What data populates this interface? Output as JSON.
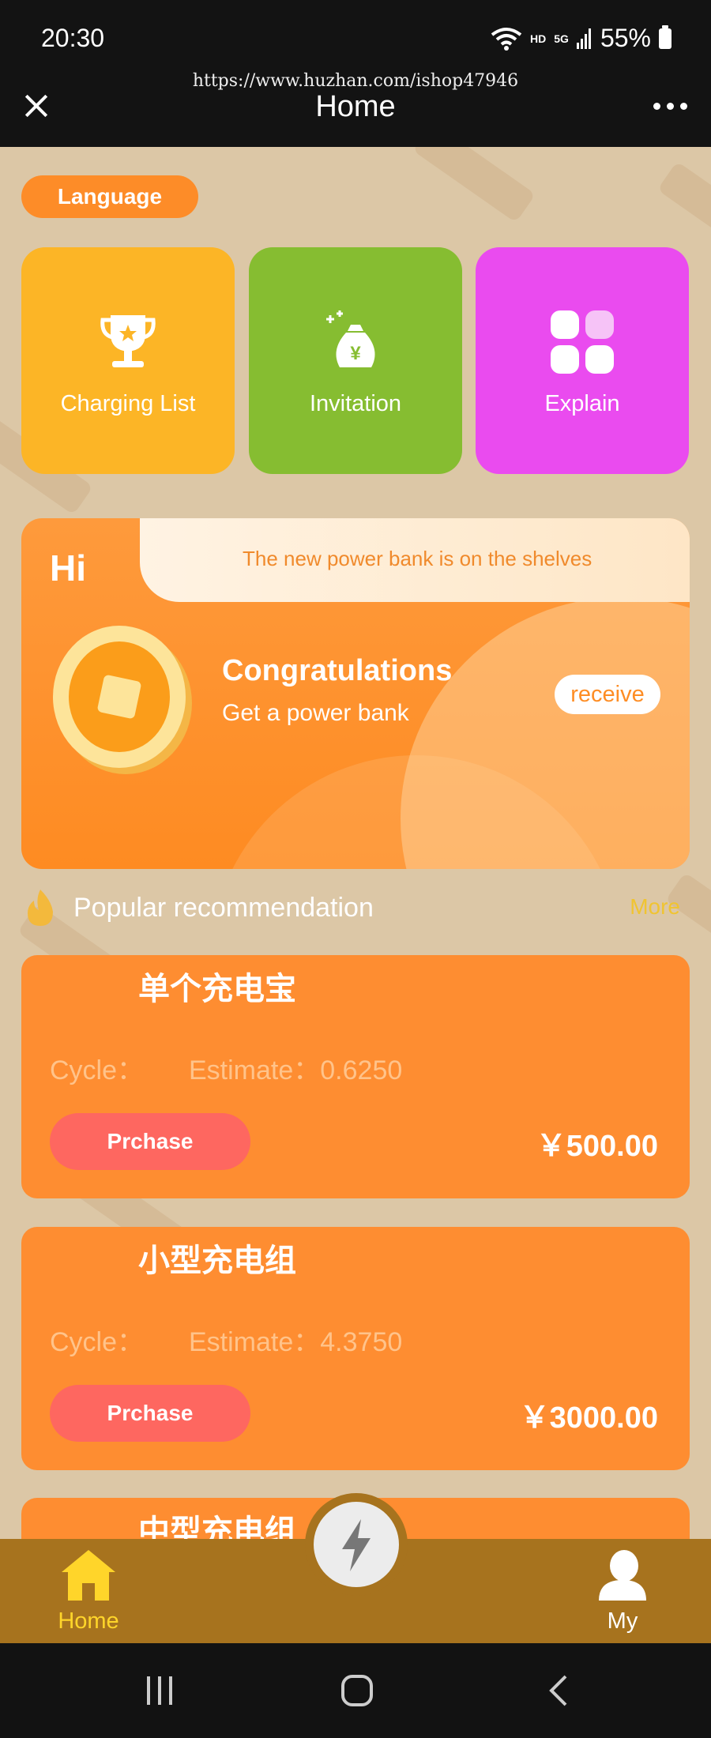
{
  "status_bar": {
    "time": "20:30",
    "network": "HD",
    "signal": "5G",
    "battery": "55%"
  },
  "browser": {
    "url": "https://www.huzhan.com/ishop47946",
    "title": "Home"
  },
  "language_button": "Language",
  "tiles": [
    {
      "label": "Charging List",
      "icon": "trophy-icon",
      "color": "#fcb526"
    },
    {
      "label": "Invitation",
      "icon": "money-bag-icon",
      "color": "#86bd31"
    },
    {
      "label": "Explain",
      "icon": "grid-icon",
      "color": "#ea4bef"
    }
  ],
  "banner": {
    "greeting": "Hi",
    "notice": "The new power bank is on the shelves",
    "headline": "Congratulations",
    "subtitle": "Get a power bank",
    "receive_label": "receive"
  },
  "recommendation": {
    "title": "Popular recommendation",
    "more": "More"
  },
  "products": [
    {
      "name": "单个充电宝",
      "cycle": "Cycle：",
      "estimate": "Estimate：0.6250",
      "button": "Prchase",
      "price": "￥500.00"
    },
    {
      "name": "小型充电组",
      "cycle": "Cycle：",
      "estimate": "Estimate：4.3750",
      "button": "Prchase",
      "price": "￥3000.00"
    },
    {
      "name": "中型充电组"
    }
  ],
  "tab_bar": {
    "home": "Home",
    "my": "My"
  },
  "colors": {
    "accent": "#fe8d31",
    "tab_bar": "#a7731e",
    "active_tab": "#ffd52a",
    "purchase_button": "#fe6760"
  }
}
